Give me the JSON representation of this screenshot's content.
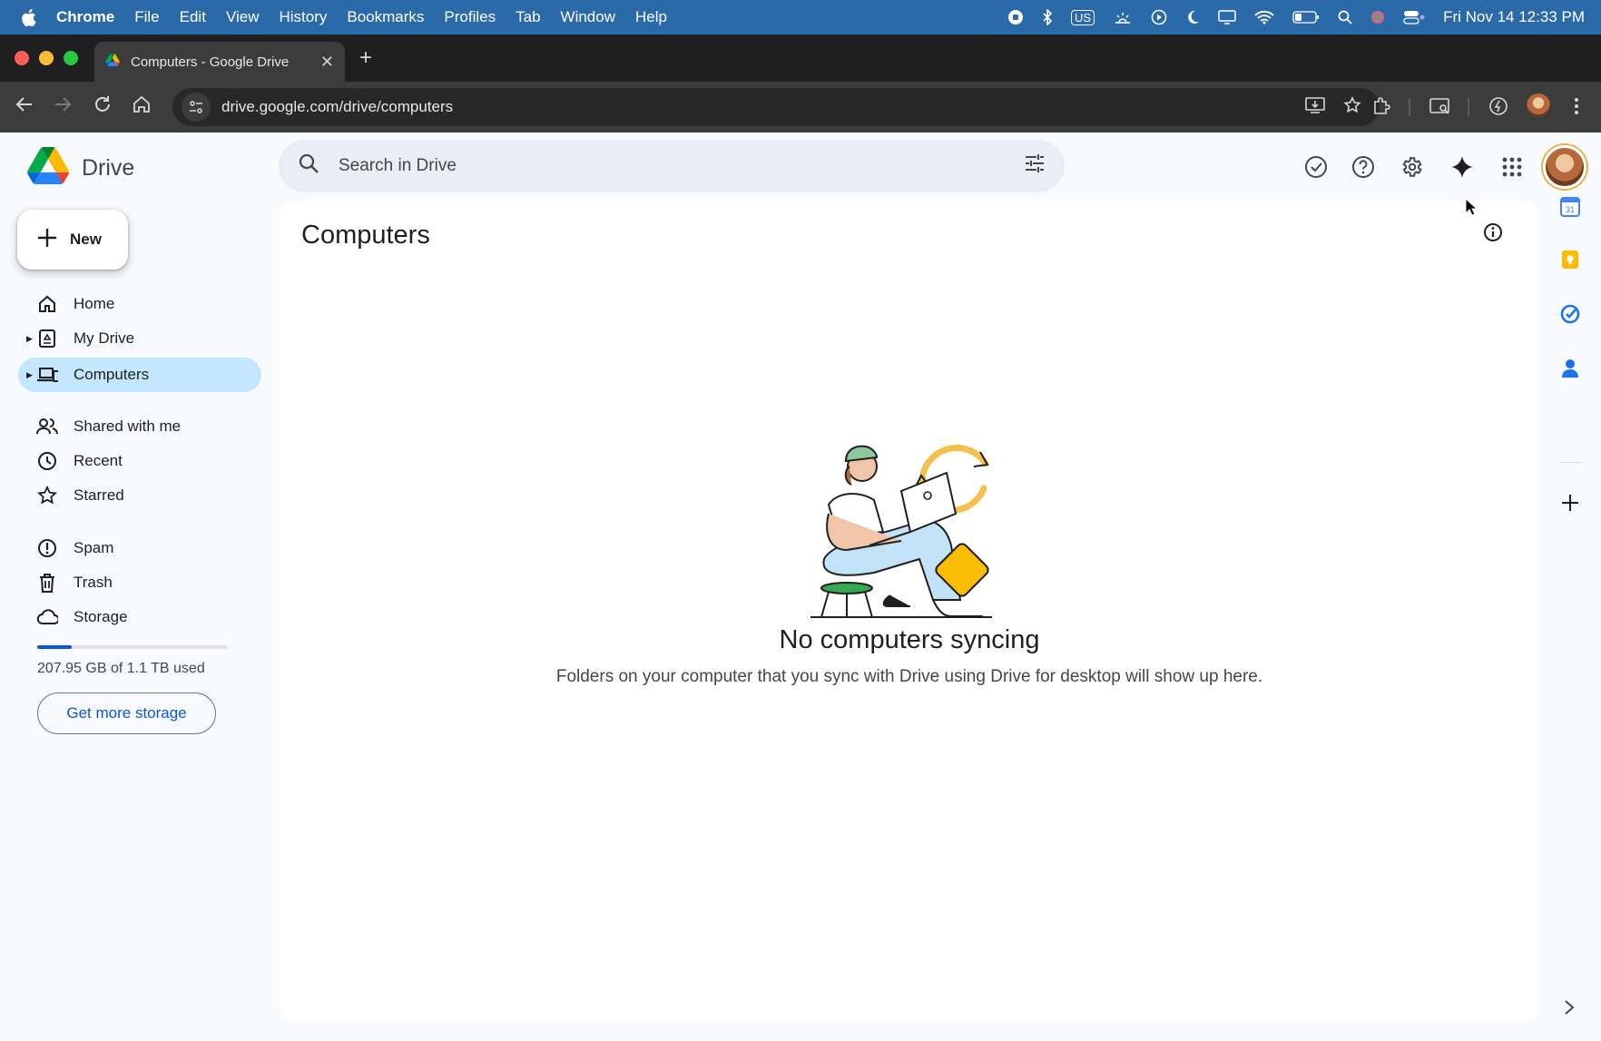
{
  "menubar": {
    "app_name": "Chrome",
    "items": [
      "File",
      "Edit",
      "View",
      "History",
      "Bookmarks",
      "Profiles",
      "Tab",
      "Window",
      "Help"
    ],
    "input_source": "US",
    "clock": "Fri Nov 14  12:33 PM"
  },
  "browser": {
    "tab_title": "Computers - Google Drive",
    "url": "drive.google.com/drive/computers"
  },
  "drive": {
    "logo_text": "Drive",
    "search_placeholder": "Search in Drive",
    "new_button": "New",
    "nav": {
      "home": "Home",
      "my_drive": "My Drive",
      "computers": "Computers",
      "shared": "Shared with me",
      "recent": "Recent",
      "starred": "Starred",
      "spam": "Spam",
      "trash": "Trash",
      "storage": "Storage"
    },
    "storage": {
      "used_text": "207.95 GB of 1.1 TB used",
      "used_fraction": 0.18,
      "button": "Get more storage"
    },
    "page_title": "Computers",
    "empty": {
      "title": "No computers syncing",
      "subtitle": "Folders on your computer that you sync with Drive using Drive for desktop will show up here."
    }
  },
  "side_panel": {
    "calendar_day": "31"
  },
  "colors": {
    "menubar": "#2a6aa8",
    "accent": "#0b57d0",
    "active_nav": "#c2e7ff",
    "page_bg": "#f8fafd"
  }
}
